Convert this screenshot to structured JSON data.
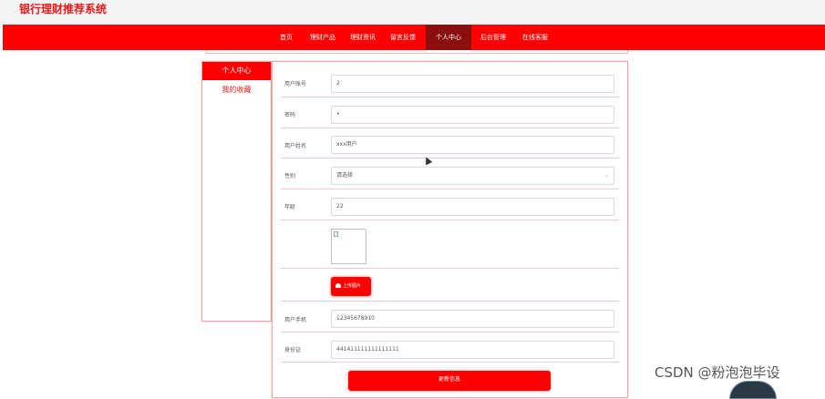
{
  "app": {
    "title": "银行理财推荐系统"
  },
  "nav": {
    "items": [
      {
        "label": "首页"
      },
      {
        "label": "理财产品"
      },
      {
        "label": "理财资讯"
      },
      {
        "label": "留言反馈"
      },
      {
        "label": "个人中心",
        "active": true
      },
      {
        "label": "后台管理"
      },
      {
        "label": "在线客服"
      }
    ]
  },
  "sidebar": {
    "items": [
      {
        "label": "个人中心",
        "active": true
      },
      {
        "label": "我的收藏"
      }
    ]
  },
  "form": {
    "account": {
      "label": "用户账号",
      "value": "2"
    },
    "password": {
      "label": "密码",
      "value": "•"
    },
    "name": {
      "label": "用户姓名",
      "value": "xxx用户"
    },
    "gender": {
      "label": "性别",
      "value": "请选择"
    },
    "age": {
      "label": "年龄",
      "value": "22"
    },
    "upload_label": "上传图片",
    "phone": {
      "label": "用户手机",
      "value": "12345678910"
    },
    "id_card": {
      "label": "身份证",
      "value": "441411111111111111"
    },
    "submit_label": "更新信息"
  },
  "watermark": "CSDN @粉泡泡毕设",
  "colors": {
    "brand": "#ff0000",
    "active_nav": "#8b0f0f",
    "title": "#e41a1a"
  }
}
